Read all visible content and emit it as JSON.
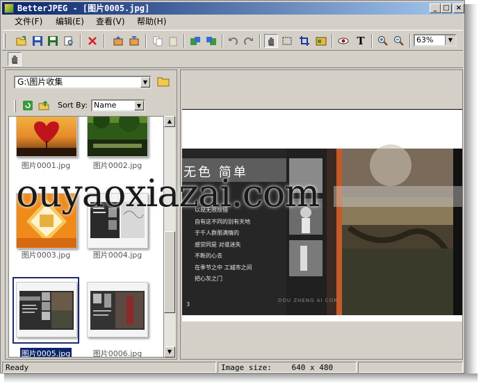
{
  "window": {
    "title": "BetterJPEG - [图片0005.jpg]",
    "controls": {
      "minimize": "_",
      "maximize": "□",
      "close": "×"
    }
  },
  "menu": {
    "file": "文件(F)",
    "edit": "编辑(E)",
    "view": "查看(V)",
    "help": "帮助(H)"
  },
  "toolbar": {
    "icons": [
      "open-icon",
      "save-icon",
      "save-as-icon",
      "print-preview-icon",
      "delete-icon",
      "prev-file-icon",
      "next-file-icon",
      "copy-icon",
      "paste-icon",
      "rotate-left-icon",
      "rotate-right-icon",
      "undo-icon",
      "redo-icon",
      "hand-tool-icon",
      "select-rect-icon",
      "crop-icon",
      "adjust-icon",
      "red-eye-icon",
      "text-icon",
      "zoom-in-icon",
      "zoom-out-icon"
    ],
    "text_tool": "T",
    "zoom_value": "63%"
  },
  "browser": {
    "path": "G:\\图片收集",
    "sort_by_label": "Sort By:",
    "sort_value": "Name",
    "thumbnails": [
      {
        "name": "图片0001.jpg",
        "selected": false
      },
      {
        "name": "图片0002.jpg",
        "selected": false
      },
      {
        "name": "图片0003.jpg",
        "selected": false
      },
      {
        "name": "图片0004.jpg",
        "selected": false
      },
      {
        "name": "图片0005.jpg",
        "selected": true
      },
      {
        "name": "图片0006.jpg",
        "selected": false
      }
    ]
  },
  "preview": {
    "headline": "无色 简单",
    "lines": [
      "以现无限烦恼",
      "自有这不同的别有天地",
      "于千人群朋满情的",
      "感觉同是 对谁迷失",
      "不断的心去",
      "在季节之中 工城市之间",
      "把心灰之门"
    ],
    "footer": "3",
    "brand_text": "DOU ZHENG AI COM"
  },
  "watermark": "ouyaoxiazai.com",
  "status": {
    "ready": "Ready",
    "image_size_label": "Image size:",
    "image_size_value": "640 x 480"
  },
  "colors": {
    "titlebar_start": "#0a246a",
    "titlebar_end": "#a6caf0",
    "selection": "#0a246a"
  }
}
